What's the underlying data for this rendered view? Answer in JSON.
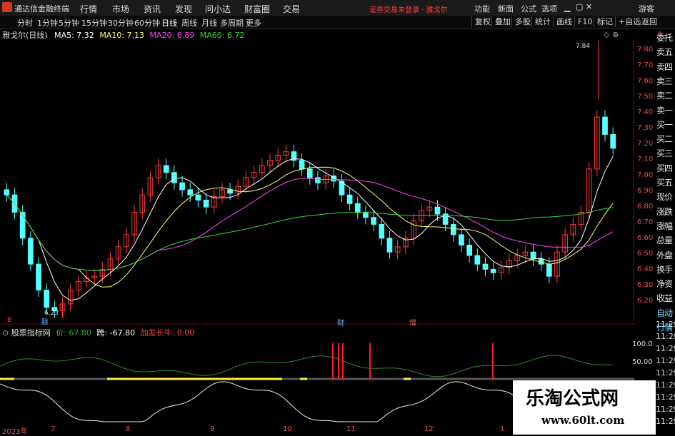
{
  "app": {
    "name": "通达信金融终端"
  },
  "menu": [
    "行情",
    "市场",
    "资讯",
    "发现",
    "问小达",
    "财富圈",
    "交易"
  ],
  "notice": "证券交易未登录 · 雅戈尔",
  "right_menu": [
    "功能",
    "新面",
    "公式",
    "选项",
    "游客"
  ],
  "periods": [
    "分时",
    "1分钟",
    "5分钟",
    "15分钟",
    "30分钟",
    "60分钟",
    "日线",
    "周线",
    "月线",
    "多周期",
    "更多"
  ],
  "active_period": "日线",
  "toolbar_buttons": [
    "复权",
    "叠加",
    "多股",
    "统计",
    "画线",
    "F10",
    "标记",
    "+自选",
    "返回"
  ],
  "stock": {
    "name": "雅戈尔(日线)"
  },
  "ma": [
    {
      "label": "MA5: 7.32",
      "color": "#ffffff"
    },
    {
      "label": "MA10: 7.13",
      "color": "#ffff66"
    },
    {
      "label": "MA20: 6.89",
      "color": "#ff44ff"
    },
    {
      "label": "MA60: 6.72",
      "color": "#33dd33"
    }
  ],
  "y_axis": {
    "unit_label": "R",
    "ticks": [
      "7.80",
      "7.70",
      "7.60",
      "7.50",
      "7.40",
      "7.30",
      "7.20",
      "7.10",
      "7.00",
      "6.90",
      "6.80",
      "6.70",
      "6.60",
      "6.50",
      "6.40",
      "6.30",
      "6.20"
    ]
  },
  "annotations": {
    "high": "7.84",
    "low": "6.23",
    "markers": [
      "财",
      "增"
    ],
    "small_red": "B",
    "small_low_mark": "翻"
  },
  "side_tabs": [
    "委托",
    "卖五",
    "卖四",
    "卖三",
    "卖二",
    "卖一",
    "买一",
    "买二",
    "买三",
    "买四",
    "买五",
    "现价",
    "涨跌",
    "涨幅",
    "总量",
    "外盘",
    "换手",
    "净资",
    "收益",
    "自动",
    "行情"
  ],
  "time_ticks": [
    "11:29",
    "11:29",
    "11:29",
    "11:29",
    "11:29",
    "11:29",
    "11:29",
    "11:29",
    "11:29"
  ],
  "indicator": {
    "name": "股票指标网",
    "value1": "价: 67.80",
    "value2": "跨: -67.80",
    "signal": "加发长牛: 0.00",
    "ticks": [
      "100.0",
      "50.00"
    ]
  },
  "x_axis": [
    "2023年",
    "7",
    "8",
    "9",
    "10",
    "11",
    "12",
    "1"
  ],
  "watermark": {
    "line1": "乐淘公式网",
    "line2": "www.60lt.com"
  },
  "chart_data": {
    "type": "candlestick",
    "ylim": [
      6.2,
      7.85
    ],
    "close": [
      6.95,
      6.85,
      6.7,
      6.55,
      6.4,
      6.3,
      6.28,
      6.32,
      6.4,
      6.45,
      6.47,
      6.48,
      6.52,
      6.58,
      6.65,
      6.72,
      6.85,
      6.95,
      7.05,
      7.12,
      7.08,
      7.02,
      6.98,
      6.95,
      6.92,
      6.88,
      6.94,
      6.98,
      6.96,
      7.0,
      7.05,
      7.08,
      7.12,
      7.15,
      7.18,
      7.2,
      7.15,
      7.1,
      7.05,
      7.02,
      7.06,
      7.03,
      6.95,
      6.9,
      6.85,
      6.82,
      6.78,
      6.7,
      6.62,
      6.65,
      6.7,
      6.8,
      6.86,
      6.88,
      6.84,
      6.78,
      6.72,
      6.66,
      6.6,
      6.55,
      6.52,
      6.5,
      6.53,
      6.57,
      6.6,
      6.62,
      6.58,
      6.55,
      6.48,
      6.62,
      6.72,
      6.78,
      6.85,
      7.1,
      7.4,
      7.3,
      7.22
    ]
  }
}
